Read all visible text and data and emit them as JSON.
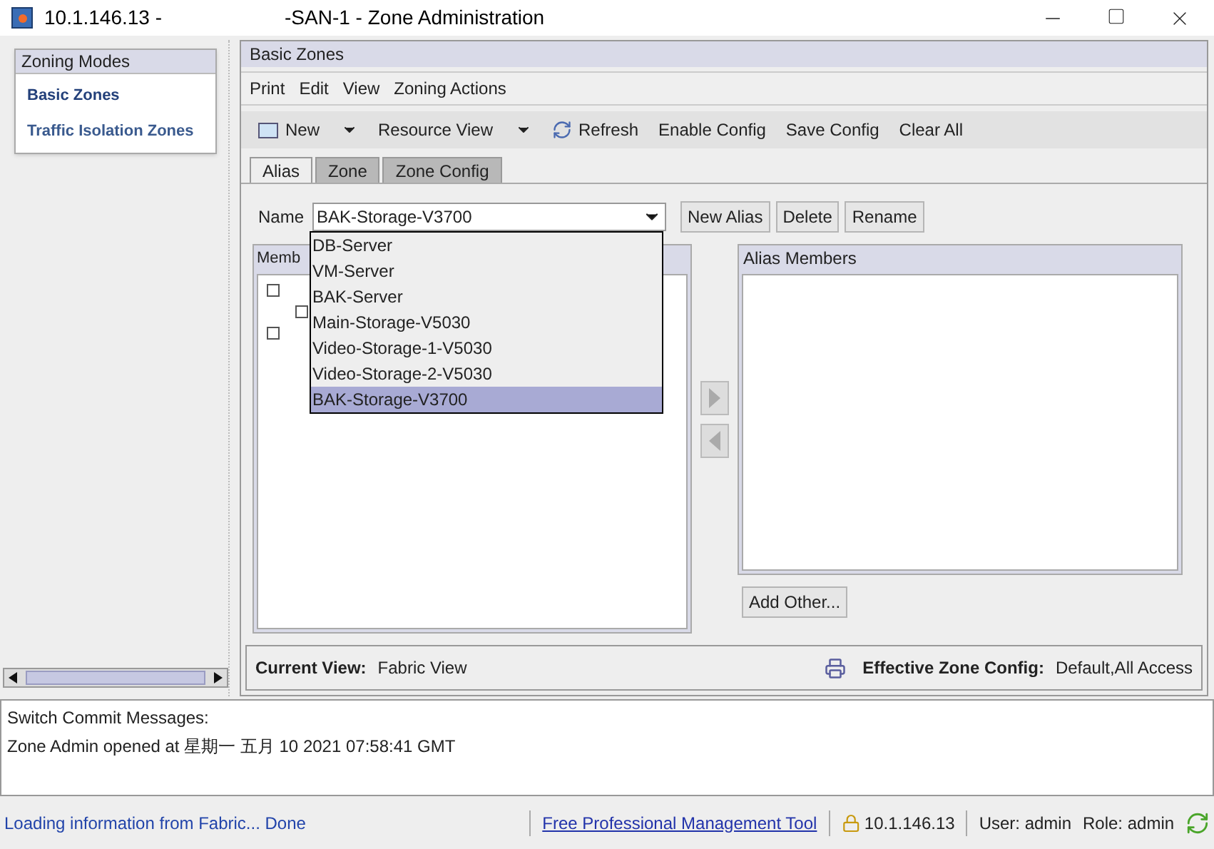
{
  "window": {
    "title_start": "10.1.146.13 -",
    "title_end": "-SAN-1 - Zone Administration"
  },
  "sidebar": {
    "title": "Zoning Modes",
    "items": [
      {
        "label": "Basic Zones",
        "selected": true
      },
      {
        "label": "Traffic Isolation Zones",
        "selected": false
      }
    ]
  },
  "panel": {
    "title": "Basic Zones"
  },
  "menu": [
    "Print",
    "Edit",
    "View",
    "Zoning Actions"
  ],
  "toolbar": [
    {
      "label": "New",
      "kind": "icon-dropdown"
    },
    {
      "label": "Resource View",
      "kind": "dropdown"
    },
    {
      "label": "Refresh",
      "kind": "icon"
    },
    {
      "label": "Enable Config",
      "kind": "plain"
    },
    {
      "label": "Save Config",
      "kind": "plain"
    },
    {
      "label": "Clear All",
      "kind": "plain"
    }
  ],
  "tabs": [
    {
      "label": "Alias",
      "selected": true
    },
    {
      "label": "Zone",
      "selected": false
    },
    {
      "label": "Zone Config",
      "selected": false
    }
  ],
  "name_field": {
    "label": "Name",
    "value": "BAK-Storage-V3700"
  },
  "name_buttons": [
    "New Alias",
    "Delete",
    "Rename"
  ],
  "dropdown": [
    {
      "label": "DB-Server",
      "selected": false
    },
    {
      "label": "VM-Server",
      "selected": false
    },
    {
      "label": "BAK-Server",
      "selected": false
    },
    {
      "label": "Main-Storage-V5030",
      "selected": false
    },
    {
      "label": "Video-Storage-1-V5030",
      "selected": false
    },
    {
      "label": "Video-Storage-2-V5030",
      "selected": false
    },
    {
      "label": "BAK-Storage-V3700",
      "selected": true
    }
  ],
  "members": {
    "title": "Memb"
  },
  "alias_members": {
    "title": "Alias Members"
  },
  "add_other": "Add Other...",
  "footer": {
    "current_view_label": "Current View:",
    "current_view": "Fabric View",
    "effective_label": "Effective Zone Config:",
    "effective": "Default,All Access"
  },
  "messages": [
    "Switch Commit Messages:",
    "Zone Admin opened at 星期一 五月 10 2021 07:58:41 GMT"
  ],
  "status_bar": {
    "message": "Loading information from Fabric... Done",
    "link": "Free Professional Management Tool",
    "ip": "10.1.146.13",
    "user": "User: admin",
    "role": "Role: admin"
  }
}
